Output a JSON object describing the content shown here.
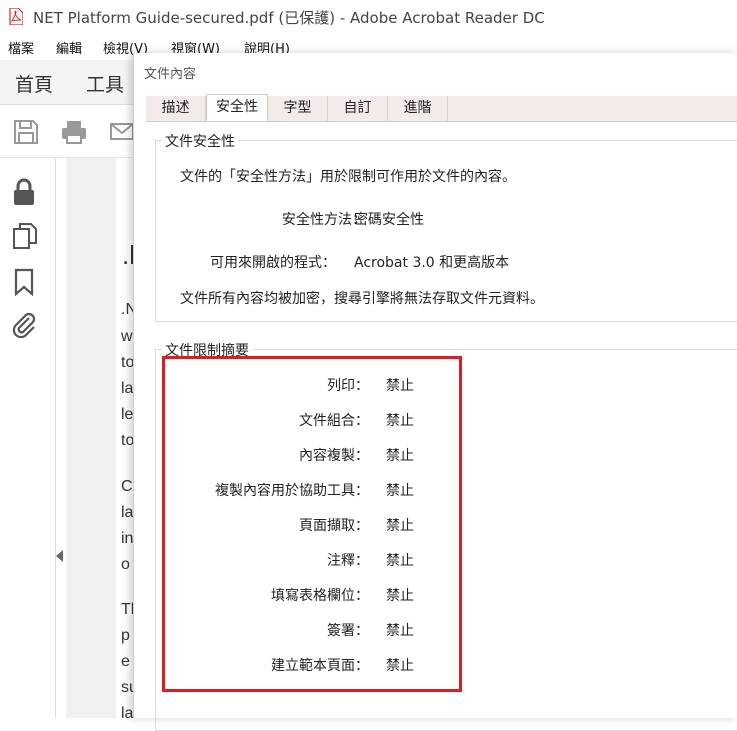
{
  "window": {
    "title": "NET Platform Guide-secured.pdf (已保護) - Adobe Acrobat Reader DC",
    "icon": "pdf-file-icon"
  },
  "menu": [
    "檔案",
    "編輯",
    "檢視(V)",
    "視窗(W)",
    "說明(H)"
  ],
  "nav_tabs": [
    "首頁",
    "工具"
  ],
  "toolbar_icons": [
    "save-icon",
    "print-icon",
    "mail-icon"
  ],
  "left_panel_icons": [
    "lock-icon",
    "pages-icon",
    "bookmark-icon",
    "attachment-icon"
  ],
  "doc_fragments": [
    ".l",
    ".N",
    "w",
    "to",
    "la",
    "le",
    "to",
    "C",
    "la",
    "in",
    "o",
    "Th",
    "p",
    "e",
    "su",
    "la"
  ],
  "dialog": {
    "title": "文件內容",
    "tabs": [
      "描述",
      "安全性",
      "字型",
      "自訂",
      "進階"
    ],
    "active_tab": "安全性",
    "security": {
      "group_title": "文件安全性",
      "intro": "文件的「安全性方法」用於限制可作用於文件的內容。",
      "method_label": "安全性方法：",
      "method_value": "密碼安全性",
      "compat_label": "可用來開啟的程式：",
      "compat_value": "Acrobat 3.0 和更高版本",
      "encrypt_note": "文件所有內容均被加密，搜尋引擎將無法存取文件元資料。"
    },
    "restrictions": {
      "group_title": "文件限制摘要",
      "items": [
        {
          "label": "列印：",
          "value": "禁止"
        },
        {
          "label": "文件組合：",
          "value": "禁止"
        },
        {
          "label": "內容複製：",
          "value": "禁止"
        },
        {
          "label": "複製內容用於協助工具：",
          "value": "禁止"
        },
        {
          "label": "頁面擷取：",
          "value": "禁止"
        },
        {
          "label": "注釋：",
          "value": "禁止"
        },
        {
          "label": "填寫表格欄位：",
          "value": "禁止"
        },
        {
          "label": "簽署：",
          "value": "禁止"
        },
        {
          "label": "建立範本頁面：",
          "value": "禁止"
        }
      ]
    }
  },
  "colors": {
    "highlight": "#e11b22",
    "tab_strip": "#f3ebea",
    "pdf_red": "#d9251c"
  }
}
